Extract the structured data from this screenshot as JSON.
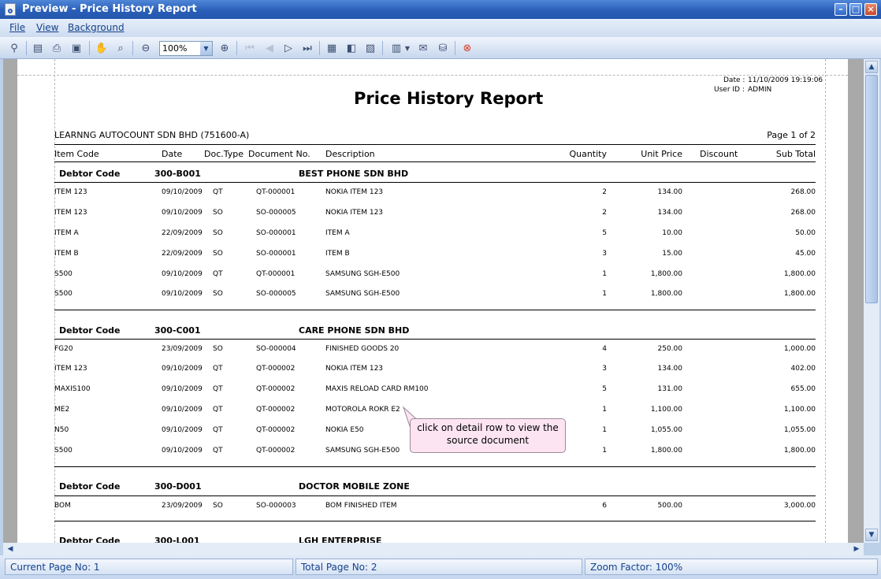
{
  "window": {
    "title": "Preview - Price History Report"
  },
  "menu": [
    "File",
    "View",
    "Background"
  ],
  "toolbar": {
    "zoom": "100%"
  },
  "status": {
    "current_page": "Current Page No: 1",
    "total_page": "Total Page No: 2",
    "zoom_factor": "Zoom Factor: 100%"
  },
  "report": {
    "date_label": "Date :",
    "date_value": "11/10/2009 19:19:06",
    "user_label": "User ID :",
    "user_value": "ADMIN",
    "title": "Price History Report",
    "company": "LEARNNG AUTOCOUNT SDN BHD (751600-A)",
    "page": "Page 1 of 2",
    "columns": [
      "Item Code",
      "Date",
      "Doc.Type",
      "Document No.",
      "Description",
      "Quantity",
      "Unit Price",
      "Discount",
      "Sub Total"
    ],
    "group_label": "Debtor Code",
    "groups": [
      {
        "code": "300-B001",
        "name": "BEST PHONE SDN BHD",
        "rows": [
          [
            "ITEM 123",
            "09/10/2009",
            "QT",
            "QT-000001",
            "NOKIA ITEM 123",
            "2",
            "134.00",
            "268.00"
          ],
          [
            "ITEM 123",
            "09/10/2009",
            "SO",
            "SO-000005",
            "NOKIA ITEM 123",
            "2",
            "134.00",
            "268.00"
          ],
          [
            "ITEM A",
            "22/09/2009",
            "SO",
            "SO-000001",
            "ITEM A",
            "5",
            "10.00",
            "50.00"
          ],
          [
            "ITEM B",
            "22/09/2009",
            "SO",
            "SO-000001",
            "ITEM B",
            "3",
            "15.00",
            "45.00"
          ],
          [
            "S500",
            "09/10/2009",
            "QT",
            "QT-000001",
            "SAMSUNG SGH-E500",
            "1",
            "1,800.00",
            "1,800.00"
          ],
          [
            "S500",
            "09/10/2009",
            "SO",
            "SO-000005",
            "SAMSUNG SGH-E500",
            "1",
            "1,800.00",
            "1,800.00"
          ]
        ]
      },
      {
        "code": "300-C001",
        "name": "CARE PHONE SDN BHD",
        "rows": [
          [
            "FG20",
            "23/09/2009",
            "SO",
            "SO-000004",
            "FINISHED GOODS 20",
            "4",
            "250.00",
            "1,000.00"
          ],
          [
            "ITEM 123",
            "09/10/2009",
            "QT",
            "QT-000002",
            "NOKIA ITEM 123",
            "3",
            "134.00",
            "402.00"
          ],
          [
            "MAXIS100",
            "09/10/2009",
            "QT",
            "QT-000002",
            "MAXIS RELOAD CARD RM100",
            "5",
            "131.00",
            "655.00"
          ],
          [
            "ME2",
            "09/10/2009",
            "QT",
            "QT-000002",
            "MOTOROLA ROKR E2",
            "1",
            "1,100.00",
            "1,100.00"
          ],
          [
            "N50",
            "09/10/2009",
            "QT",
            "QT-000002",
            "NOKIA E50",
            "1",
            "1,055.00",
            "1,055.00"
          ],
          [
            "S500",
            "09/10/2009",
            "QT",
            "QT-000002",
            "SAMSUNG SGH-E500",
            "1",
            "1,800.00",
            "1,800.00"
          ]
        ]
      },
      {
        "code": "300-D001",
        "name": "DOCTOR MOBILE ZONE",
        "rows": [
          [
            "BOM",
            "23/09/2009",
            "SO",
            "SO-000003",
            "BOM FINISHED ITEM",
            "6",
            "500.00",
            "3,000.00"
          ]
        ]
      },
      {
        "code": "300-L001",
        "name": "LGH ENTERPRISE",
        "rows": []
      }
    ]
  },
  "callout": "click on detail row to view the source document"
}
